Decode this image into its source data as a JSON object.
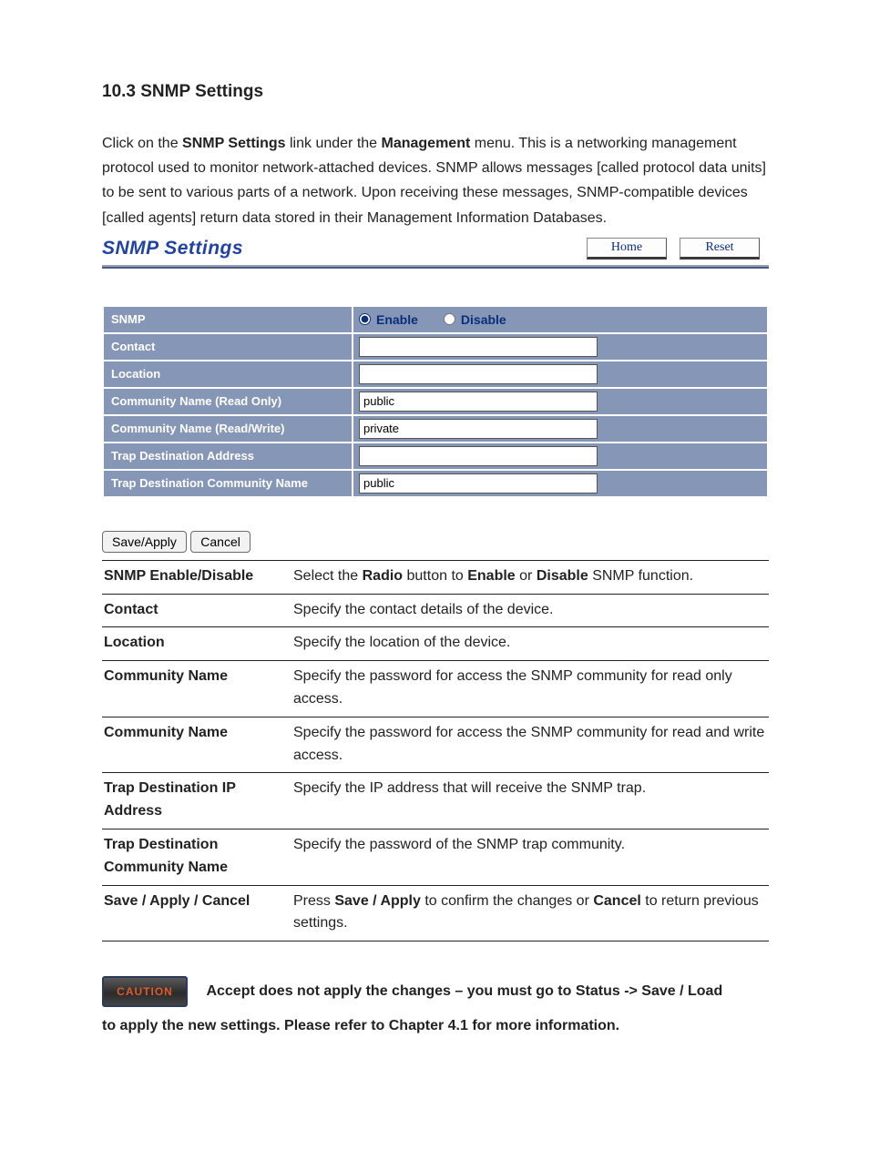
{
  "heading": "10.3 SNMP Settings",
  "intro_parts": {
    "p1": "Click on the ",
    "b1": "SNMP Settings",
    "p2": " link under the ",
    "b2": "Management",
    "p3": " menu. This is a networking management protocol used to monitor network-attached devices. SNMP allows messages [called protocol data units] to be sent to various parts of a network. Upon receiving these messages, SNMP-compatible devices [called agents] return data stored in their Management Information Databases."
  },
  "panel": {
    "title": "SNMP Settings",
    "home": "Home",
    "reset": "Reset"
  },
  "form": {
    "rows": {
      "snmp": "SNMP",
      "contact": "Contact",
      "location": "Location",
      "comm_ro": "Community Name (Read Only)",
      "comm_rw": "Community Name (Read/Write)",
      "trap_addr": "Trap Destination Address",
      "trap_comm": "Trap Destination Community Name"
    },
    "enable": "Enable",
    "disable": "Disable",
    "snmp_selected": "enable",
    "values": {
      "contact": "",
      "location": "",
      "comm_ro": "public",
      "comm_rw": "private",
      "trap_addr": "",
      "trap_comm": "public"
    }
  },
  "buttons": {
    "save": "Save/Apply",
    "cancel": "Cancel"
  },
  "desc": [
    {
      "term": "SNMP Enable/Disable",
      "text": [
        {
          "t": "Select the "
        },
        {
          "b": "Radio"
        },
        {
          "t": " button to "
        },
        {
          "b": "Enable"
        },
        {
          "t": " or "
        },
        {
          "b": "Disable"
        },
        {
          "t": " SNMP function."
        }
      ]
    },
    {
      "term": "Contact",
      "text": [
        {
          "t": "Specify the contact details of the device."
        }
      ]
    },
    {
      "term": "Location",
      "text": [
        {
          "t": "Specify the location of the device."
        }
      ]
    },
    {
      "term": "Community Name",
      "text": [
        {
          "t": "Specify the password for access the SNMP community for read only access."
        }
      ]
    },
    {
      "term": "Community Name",
      "text": [
        {
          "t": "Specify the password for access the SNMP community for read and write access."
        }
      ]
    },
    {
      "term": "Trap Destination IP Address",
      "text": [
        {
          "t": "Specify the IP address that will receive the SNMP trap."
        }
      ]
    },
    {
      "term": "Trap Destination Community Name",
      "text": [
        {
          "t": "Specify the password of the SNMP trap community."
        }
      ]
    },
    {
      "term": "Save / Apply / Cancel",
      "text": [
        {
          "t": "Press "
        },
        {
          "b": "Save / Apply"
        },
        {
          "t": " to confirm the changes or "
        },
        {
          "b": "Cancel"
        },
        {
          "t": " to return previous settings."
        }
      ]
    }
  ],
  "caution": {
    "label": "CAUTION",
    "line1": "Accept does not apply the changes – you must go to Status -> Save / Load",
    "line2": "to apply the new settings. Please refer to Chapter 4.1 for more information."
  }
}
